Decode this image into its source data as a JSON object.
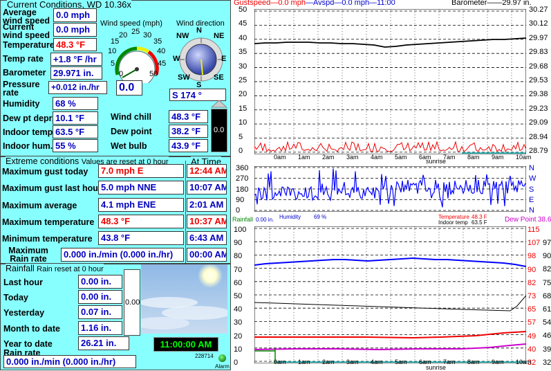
{
  "current": {
    "title": "Current Conditions, WD 10.36x",
    "avg_wind_label": "Average wind speed",
    "avg_wind": "0.0 mph",
    "cur_wind_label": "Current wind speed",
    "cur_wind": "0.0 mph",
    "temp_label": "Temperature",
    "temp": "48.3 °F",
    "temp_rate_label": "Temp rate",
    "temp_rate": "+1.8 °F /hr",
    "baro_label": "Barometer",
    "baro": "29.971 in.",
    "press_rate_label": "Pressure rate",
    "press_rate": "+0.012 in./hr",
    "humidity_label": "Humidity",
    "humidity": "68 %",
    "dew_dep_label": "Dew pt depr.",
    "dew_dep": "10.1 °F",
    "indoor_temp_label": "Indoor temp.",
    "indoor_temp": "63.5 °F",
    "indoor_hum_label": "Indoor hum.",
    "indoor_hum": "55 %",
    "wind_chill_label": "Wind chill",
    "wind_chill": "48.3 °F",
    "dew_point_label": "Dew point",
    "dew_point": "38.2 °F",
    "wet_bulb_label": "Wet bulb",
    "wet_bulb": "43.9 °F",
    "speed_gauge_title": "Wind speed (mph)",
    "speed_gauge_ticks": [
      "0",
      "5",
      "10",
      "15",
      "20",
      "25",
      "30",
      "35",
      "40",
      "45",
      "50"
    ],
    "speed_value": "0.0",
    "dir_gauge_title": "Wind direction",
    "dir_compass": [
      "N",
      "NE",
      "E",
      "SE",
      "S",
      "SW",
      "W",
      "NW"
    ],
    "dir_value": "S 174 °",
    "dir_degrees": 174,
    "right_box": "0.0"
  },
  "extreme": {
    "title": "Extreme conditions",
    "reset_note": "Values are reset at 0 hour",
    "time_header": "At Time",
    "rows": [
      {
        "label": "Maximum gust today",
        "value": "7.0 mph   E",
        "time": "12:44 AM",
        "red": true
      },
      {
        "label": "Maximum gust last hour",
        "value": "5.0 mph NNE",
        "time": "10:07 AM",
        "red": false
      },
      {
        "label": "Maximum average",
        "value": "4.1 mph ENE",
        "time": "2:01 AM",
        "red": false
      },
      {
        "label": "Maximum temperature",
        "value": "48.3 °F",
        "time": "10:37 AM",
        "red": true
      },
      {
        "label": "Minimum temperature",
        "value": "43.8 °F",
        "time": "6:43 AM",
        "red": false
      }
    ],
    "max_rain_label": "Maximum Rain rate",
    "max_rain": "0.000 in./min (0.000 in./hr)",
    "max_rain_time": "00:00 AM"
  },
  "rainfall": {
    "title": "Rainfall",
    "reset_note": "Rain reset at 0 hour",
    "rows": [
      {
        "label": "Last hour",
        "value": "0.00 in."
      },
      {
        "label": "Today",
        "value": "0.00 in."
      },
      {
        "label": "Yesterday",
        "value": "0.07 in."
      },
      {
        "label": "Month to date",
        "value": "1.16 in."
      },
      {
        "label": "Year to date",
        "value": "26.21 in."
      }
    ],
    "rate_label": "Rain rate",
    "rate": "0.000 in./min (0.000 in./hr)",
    "gauge_value": "0.00",
    "clock": "11:00:00 AM",
    "counter": "228714",
    "alarm_label": "Alarm"
  },
  "graph_top": {
    "legend_gust": "Gustspeed",
    "legend_gust_val": "0.0 mph",
    "legend_avg": "Avspd",
    "legend_avg_val": "0.0 mph",
    "legend_time": "11:00",
    "legend_baro": "Barometer",
    "legend_baro_val": "29.97 in.",
    "left_ticks": [
      "50",
      "45",
      "40",
      "35",
      "30",
      "25",
      "20",
      "15",
      "10",
      "5",
      "0"
    ],
    "right_ticks": [
      "30.27",
      "30.12",
      "29.97",
      "29.83",
      "29.68",
      "29.53",
      "29.38",
      "29.23",
      "29.09",
      "28.94",
      "28.79"
    ],
    "hours": [
      "0am",
      "1am",
      "2am",
      "3am",
      "4am",
      "5am",
      "6am",
      "7am",
      "8am",
      "9am",
      "10am"
    ],
    "sunrise": "sunrise"
  },
  "graph_mid": {
    "left_ticks": [
      "360",
      "270",
      "180",
      "90",
      "0"
    ],
    "right_ticks": [
      "N",
      "W",
      "S",
      "E",
      "N"
    ],
    "rain_label": "Rainfall",
    "rain_val": "0.00 in.",
    "hum_label": "Humidity",
    "hum_val": "69 %",
    "temp_label": "Temperature",
    "temp_val": "48.3 F",
    "indoor_label": "Indoor temp",
    "indoor_val": "63.5 F",
    "dew_label": "Dew Point",
    "dew_val": "38.6"
  },
  "graph_bot": {
    "left_ticks": [
      "100",
      "90",
      "80",
      "70",
      "60",
      "50",
      "40",
      "30",
      "20",
      "10",
      "0"
    ],
    "r1_ticks": [
      "115",
      "107",
      "98",
      "90",
      "82",
      "73",
      "65",
      "57",
      "49",
      "40",
      "32"
    ],
    "r2_ticks": [
      "97",
      "90",
      "82",
      "75",
      "68",
      "61",
      "54",
      "46",
      "39",
      "32"
    ],
    "hours": [
      "0am",
      "1am",
      "2am",
      "3am",
      "4am",
      "5am",
      "6am",
      "7am",
      "8am",
      "9am",
      "10am"
    ],
    "sunrise": "sunrise"
  },
  "colors": {
    "panel": "#88ffff",
    "value_blue": "#0000c0",
    "value_red": "#ee0000",
    "gust": "#ff0000",
    "direction": "#0000ff"
  }
}
